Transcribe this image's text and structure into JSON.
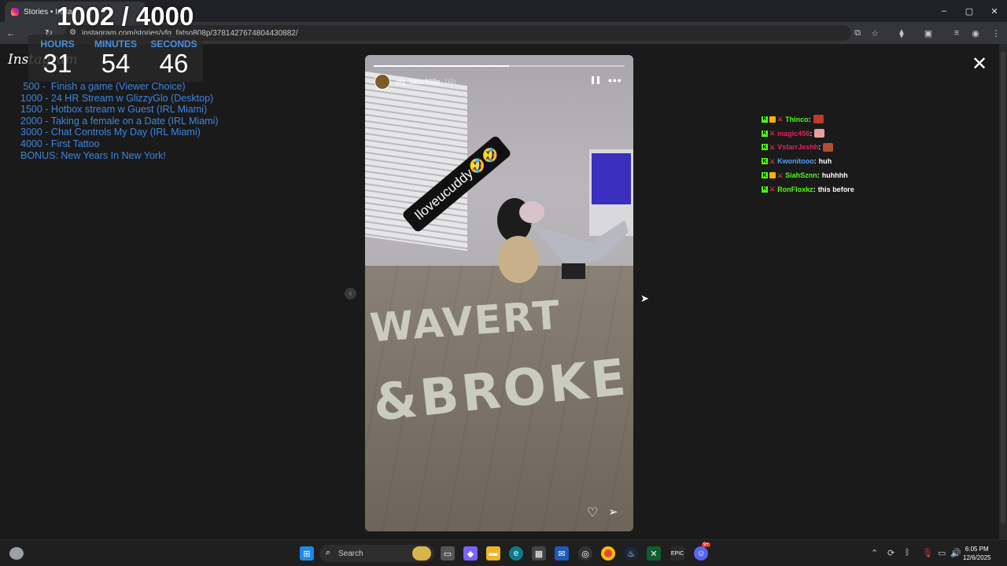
{
  "browser": {
    "tab_title": "Stories • Insta",
    "url": "instagram.com/stories/yfg_fatso808p/3781427674804430882/",
    "window_controls": [
      "–",
      "▢",
      "✕"
    ]
  },
  "stream_overlay": {
    "counter": "1002 / 4000",
    "timer": {
      "hours_label": "HOURS",
      "hours": "31",
      "minutes_label": "MINUTES",
      "minutes": "54",
      "seconds_label": "SECONDS",
      "seconds": "46"
    },
    "goals": [
      " 500 -  Finish a game (Viewer Choice)",
      "1000 - 24 HR Stream w GlizzyGlo (Desktop)",
      "1500 - Hotbox stream w Guest (IRL Miami)",
      "2000 - Taking a female on a Date (IRL Miami)",
      "3000 - Chat Controls My Day (IRL Miami)",
      "4000 - First Tattoo",
      "BONUS: New Years In New York!"
    ]
  },
  "instagram": {
    "logo": "Instagram",
    "story": {
      "username": "yfg_fatso808p",
      "time": "16h",
      "sticker_text": "Iloveucuddy🤣🤣",
      "progress": 0.54,
      "money_text_line1": "WAVERT",
      "money_text_line2": "&BROKE"
    }
  },
  "chat": [
    {
      "user": "Thinco",
      "color": "#53fc18",
      "badge": "sub",
      "message": "",
      "emote": "#c0392b"
    },
    {
      "user": "magic456",
      "color": "#e0245e",
      "badge": "none",
      "message": "",
      "emote": "#e8a0a0"
    },
    {
      "user": "VstarrJxshh",
      "color": "#e0245e",
      "badge": "none",
      "message": "",
      "emote": "#b05030"
    },
    {
      "user": "Kwonitooo",
      "color": "#4aa3ff",
      "badge": "none",
      "message": "huh",
      "emote": ""
    },
    {
      "user": "SiahSznn",
      "color": "#53fc18",
      "badge": "sub",
      "message": "huhhhh",
      "emote": ""
    },
    {
      "user": "RonFloxkz",
      "color": "#53fc18",
      "badge": "none",
      "message": "this before",
      "emote": ""
    }
  ],
  "taskbar": {
    "search_placeholder": "Search",
    "time": "6:05 PM",
    "date": "12/6/2025",
    "discord_badge": "9+"
  }
}
